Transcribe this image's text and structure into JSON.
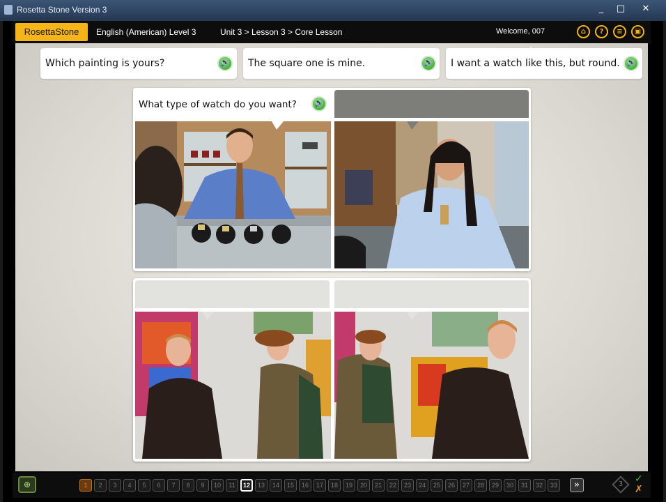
{
  "window": {
    "title": "Rosetta Stone Version 3",
    "controls": [
      "_",
      "□",
      "✕"
    ]
  },
  "header": {
    "logo": "RosettaStone",
    "course": "English (American) Level 3",
    "breadcrumb": "Unit 3 > Lesson 3 > Core Lesson",
    "welcome": "Welcome, 007",
    "buttons": [
      "home-icon",
      "help-icon",
      "menu-icon",
      "settings-icon"
    ]
  },
  "phrases": [
    {
      "text": "Which painting is yours?"
    },
    {
      "text": "The square one is mine."
    },
    {
      "text": "I want a watch like this, but round."
    }
  ],
  "panels": [
    {
      "caption": "What type of watch do you want?",
      "state": "filled"
    },
    {
      "caption": "",
      "state": "selected"
    },
    {
      "caption": "",
      "state": "empty"
    },
    {
      "caption": "",
      "state": "empty"
    }
  ],
  "colors": {
    "accent": "#f5b418",
    "speaker": "#2b9a2b",
    "done_page": "#e08a30",
    "check": "#3cc23c",
    "cross": "#e0a020"
  },
  "footer": {
    "pages": [
      "1",
      "2",
      "3",
      "4",
      "5",
      "6",
      "7",
      "8",
      "9",
      "10",
      "11",
      "12",
      "13",
      "14",
      "15",
      "16",
      "17",
      "18",
      "19",
      "20",
      "21",
      "22",
      "23",
      "24",
      "25",
      "26",
      "27",
      "28",
      "29",
      "30",
      "31",
      "32",
      "33"
    ],
    "current_page": "12",
    "done_pages": [
      "1"
    ],
    "next": "»",
    "diamond_count": "3",
    "check": "✓",
    "cross": "✗"
  }
}
